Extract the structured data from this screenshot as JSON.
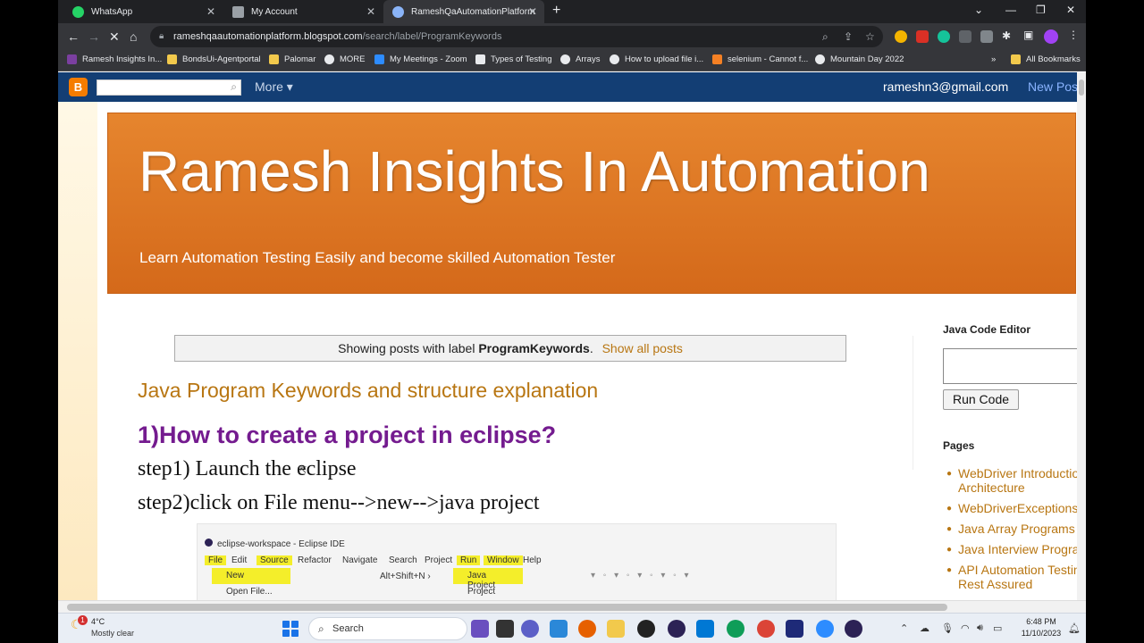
{
  "tabs": [
    {
      "title": "WhatsApp",
      "color": "#25d366"
    },
    {
      "title": "My Account",
      "color": "#9aa0a6"
    },
    {
      "title": "RameshQaAutomationPlatform",
      "color": "#8ab4f8"
    }
  ],
  "address": {
    "host": "rameshqaautomationplatform.blogspot.com",
    "path": "/search/label/ProgramKeywords"
  },
  "bookmarks": [
    "Ramesh Insights In...",
    "BondsUi-Agentportal",
    "Palomar",
    "MORE",
    "My Meetings - Zoom",
    "Types of Testing",
    "Arrays",
    "How to upload file i...",
    "selenium - Cannot f...",
    "Mountain Day 2022"
  ],
  "bookmarks_more": "»",
  "all_bookmarks": "All Bookmarks",
  "navbar": {
    "logo": "B",
    "more_label": "More ▾",
    "email": "rameshn3@gmail.com",
    "new_post": "New Post"
  },
  "blog": {
    "title": "Ramesh Insights In Automation",
    "description": "Learn Automation Testing Easily and become skilled Automation Tester"
  },
  "status": {
    "prefix": "Showing posts with label",
    "label": "ProgramKeywords",
    "suffix": ".",
    "show_all": "Show all posts"
  },
  "post": {
    "title": "Java Program Keywords and structure explanation",
    "heading": "1)How to create a project in eclipse?",
    "step1": "step1) Launch the eclipse",
    "step2": "step2)click on File menu-->new-->java project"
  },
  "eclipse": {
    "window_title": "eclipse-workspace - Eclipse IDE",
    "menus": [
      "File",
      "Edit",
      "Source",
      "Refactor",
      "Navigate",
      "Search",
      "Project",
      "Run",
      "Window",
      "Help"
    ],
    "new_item": "New",
    "shortcut": "Alt+Shift+N ›",
    "java_project": "Java Project",
    "open_file": "Open File...",
    "project": "Project"
  },
  "sidebar": {
    "code_editor_title": "Java Code Editor",
    "run_code": "Run Code",
    "pages_title": "Pages",
    "pages": [
      "WebDriver Introductio",
      "Architecture",
      "WebDriverExceptions",
      "Java Array Programs",
      "Java Interview Progra",
      "API Automation Testin",
      "Rest Assured"
    ]
  },
  "taskbar": {
    "weather_temp": "4°C",
    "weather_desc": "Mostly clear",
    "weather_badge": "1",
    "search_label": "Search",
    "time": "6:48 PM",
    "date": "11/10/2023"
  },
  "colors": {
    "accent_link": "#b87612",
    "heading_purple": "#741b8f",
    "banner": "#e07a26",
    "navbar": "#133e74"
  }
}
